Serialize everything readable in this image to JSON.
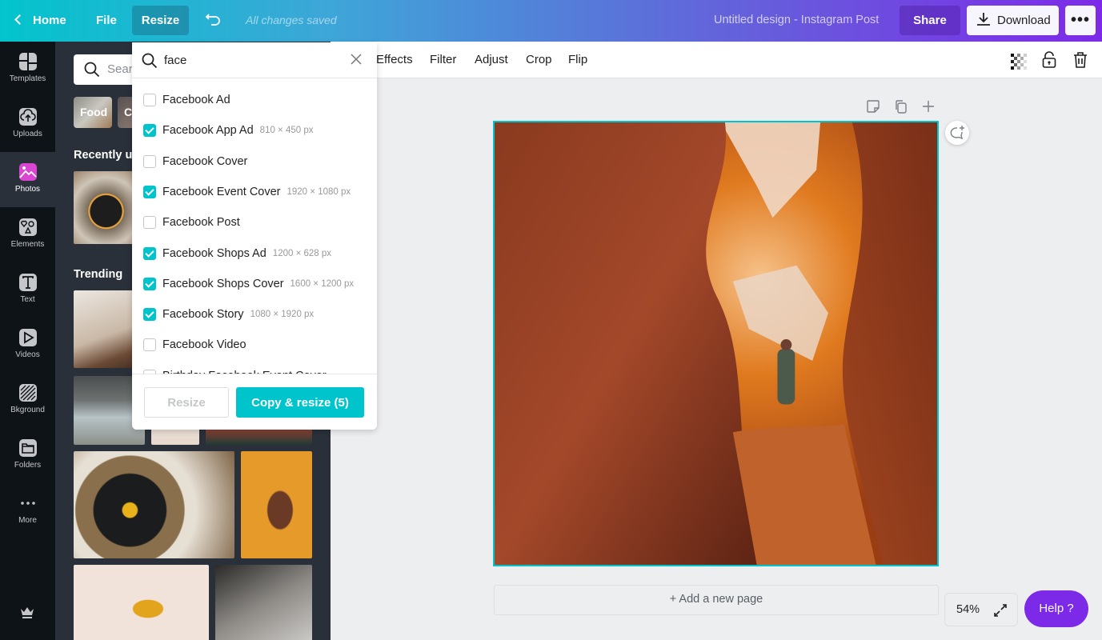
{
  "topbar": {
    "home_label": "Home",
    "file_label": "File",
    "resize_label": "Resize",
    "save_status": "All changes saved",
    "design_title": "Untitled design - Instagram Post",
    "share_label": "Share",
    "download_label": "Download",
    "more_label": "•••"
  },
  "sidebar": {
    "items": [
      {
        "label": "Templates",
        "icon": "templates-icon"
      },
      {
        "label": "Uploads",
        "icon": "upload-cloud-icon"
      },
      {
        "label": "Photos",
        "icon": "photos-icon",
        "active": true
      },
      {
        "label": "Elements",
        "icon": "shapes-icon"
      },
      {
        "label": "Text",
        "icon": "text-icon"
      },
      {
        "label": "Videos",
        "icon": "play-icon"
      },
      {
        "label": "Bkground",
        "icon": "background-icon"
      },
      {
        "label": "Folders",
        "icon": "folder-icon"
      },
      {
        "label": "More",
        "icon": "more-dots-icon"
      }
    ],
    "accent": "#d946d1"
  },
  "panel": {
    "search_placeholder": "Search photos",
    "chips": [
      "Food",
      "Coffee"
    ],
    "recently_used_heading": "Recently used",
    "trending_heading": "Trending"
  },
  "resize_dropdown": {
    "search_value": "face",
    "options": [
      {
        "label": "Facebook Ad",
        "checked": false,
        "dims": ""
      },
      {
        "label": "Facebook App Ad",
        "checked": true,
        "dims": "810 × 450 px"
      },
      {
        "label": "Facebook Cover",
        "checked": false,
        "dims": ""
      },
      {
        "label": "Facebook Event Cover",
        "checked": true,
        "dims": "1920 × 1080 px"
      },
      {
        "label": "Facebook Post",
        "checked": false,
        "dims": ""
      },
      {
        "label": "Facebook Shops Ad",
        "checked": true,
        "dims": "1200 × 628 px"
      },
      {
        "label": "Facebook Shops Cover",
        "checked": true,
        "dims": "1600 × 1200 px"
      },
      {
        "label": "Facebook Story",
        "checked": true,
        "dims": "1080 × 1920 px"
      },
      {
        "label": "Facebook Video",
        "checked": false,
        "dims": ""
      },
      {
        "label": "Birthday Facebook Event Cover",
        "checked": false,
        "dims": ""
      }
    ],
    "resize_button": "Resize",
    "copy_resize_button": "Copy & resize (5)",
    "accent": "#00c4cc"
  },
  "context_toolbar": {
    "items": [
      "Effects",
      "Filter",
      "Adjust",
      "Crop",
      "Flip"
    ]
  },
  "canvas": {
    "add_page_label": "+ Add a new page",
    "zoom_level": "54%",
    "help_label": "Help  ?",
    "selection_color": "#00c4cc"
  }
}
